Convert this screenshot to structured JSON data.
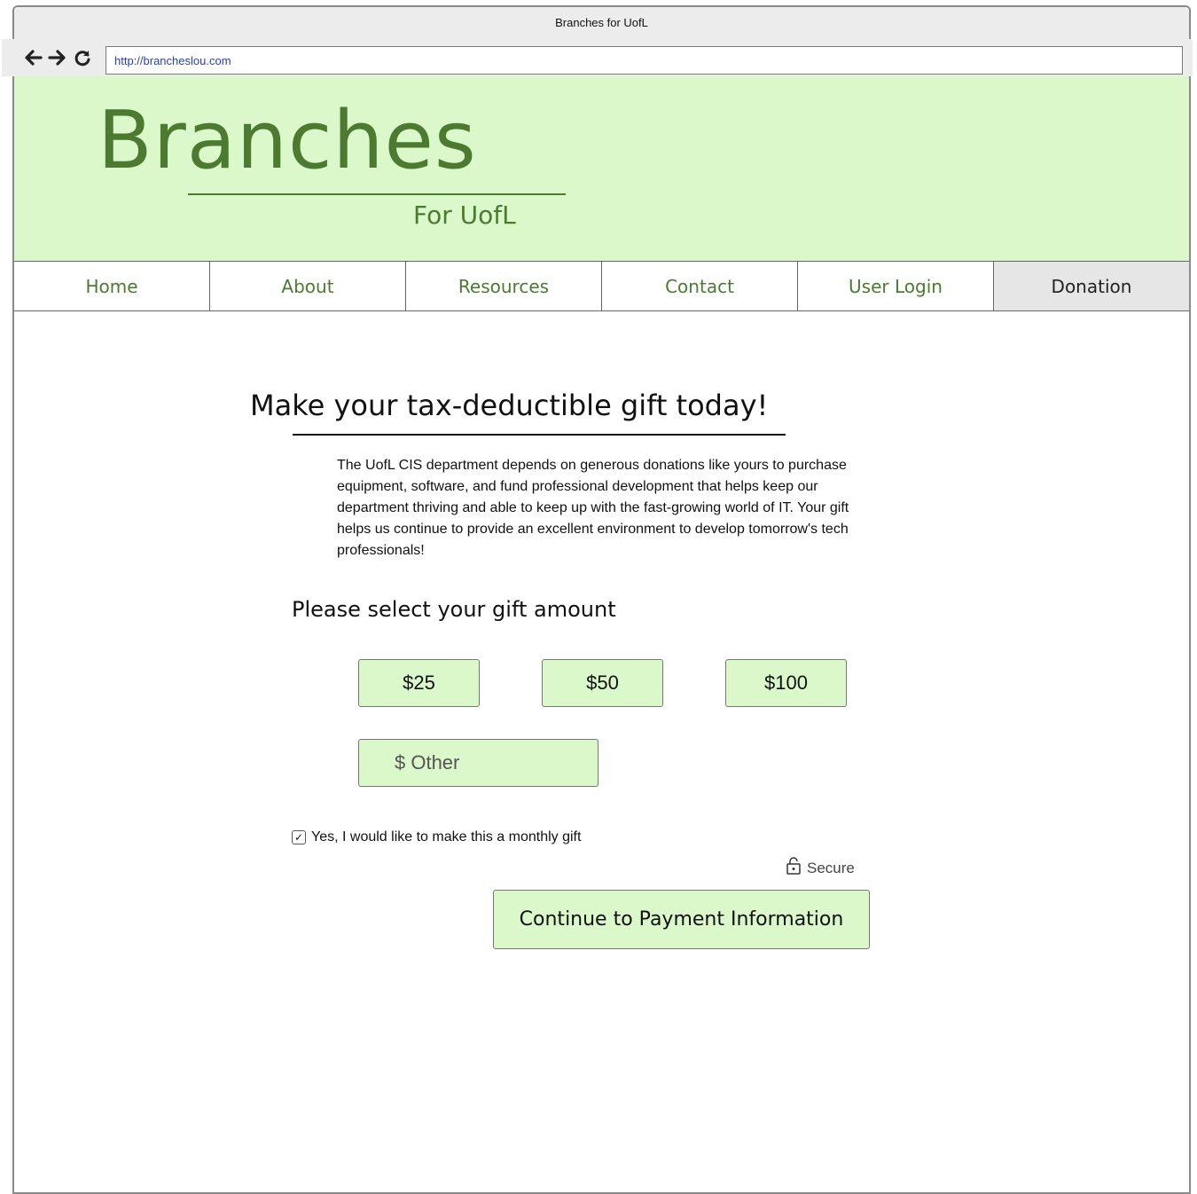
{
  "browser": {
    "window_title": "Branches for UofL",
    "url": "http://brancheslou.com",
    "icons": [
      "back-arrow-icon",
      "forward-arrow-icon",
      "reload-icon"
    ]
  },
  "site": {
    "logo": "Branches",
    "subtitle": "For UofL",
    "brand_color": "#4b7a30",
    "header_bg": "#daf8c9"
  },
  "nav": {
    "items": [
      "Home",
      "About",
      "Resources",
      "Contact",
      "User Login",
      "Donation"
    ],
    "active": "Donation"
  },
  "main": {
    "heading": "Make your tax-deductible gift today!",
    "intro": "The UofL CIS department depends on generous donations like yours to purchase equipment, software, and fund professional development that helps keep our department thriving and able to keep up with the fast-growing world of IT. Your gift helps us continue to provide an excellent environment to develop tomorrow's tech professionals!",
    "select_label": "Please select your gift amount",
    "amounts": [
      "$25",
      "$50",
      "$100"
    ],
    "other_placeholder": "$ Other",
    "monthly_label": "Yes, I would like to make this a monthly gift",
    "monthly_checked": true,
    "secure_label": "Secure",
    "continue_label": "Continue to Payment Information"
  }
}
